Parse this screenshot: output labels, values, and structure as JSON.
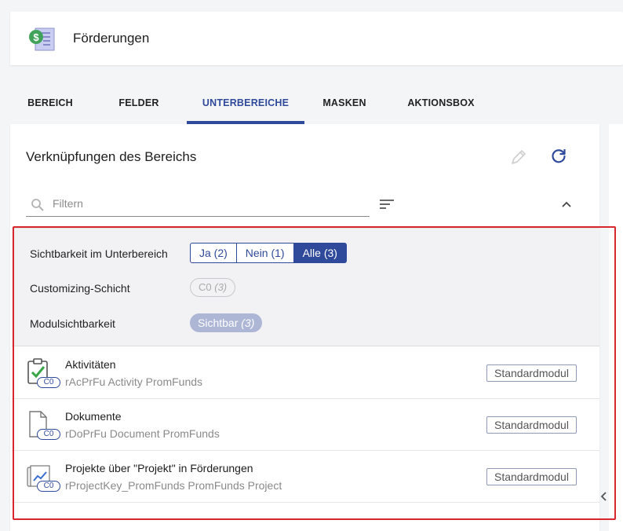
{
  "header": {
    "title": "Förderungen",
    "icon": "money-document-icon"
  },
  "tabs": [
    {
      "label": "BEREICH"
    },
    {
      "label": "FELDER"
    },
    {
      "label": "UNTERBEREICHE",
      "active": true
    },
    {
      "label": "MASKEN"
    },
    {
      "label": "AKTIONSBOX"
    }
  ],
  "panel": {
    "title": "Verknüpfungen des Bereichs",
    "filter_placeholder": "Filtern",
    "filter_value": ""
  },
  "filters": {
    "visibility_label": "Sichtbarkeit im Unterbereich",
    "visibility_options": [
      "Ja (2)",
      "Nein (1)",
      "Alle (3)"
    ],
    "visibility_selected": "Alle (3)",
    "customizing_label": "Customizing-Schicht",
    "customizing_chip": {
      "label": "C0",
      "count": "(3)"
    },
    "module_label": "Modulsichtbarkeit",
    "module_chip": {
      "label": "Sichtbar",
      "count": "(3)"
    }
  },
  "items": [
    {
      "title": "Aktivitäten",
      "subtitle": "rAcPrFu Activity PromFunds",
      "layer": "C0",
      "badge": "Standardmodul",
      "icon": "clipboard-check-icon"
    },
    {
      "title": "Dokumente",
      "subtitle": "rDoPrFu Document PromFunds",
      "layer": "C0",
      "badge": "Standardmodul",
      "icon": "document-icon"
    },
    {
      "title": "Projekte über \"Projekt\" in Förderungen",
      "subtitle": "rProjectKey_PromFunds PromFunds Project",
      "layer": "C0",
      "badge": "Standardmodul",
      "icon": "project-chart-icon"
    }
  ],
  "colors": {
    "accent": "#2f4a9b",
    "highlight_border": "#d7262c",
    "chip_fill": "#aeb6d6"
  }
}
